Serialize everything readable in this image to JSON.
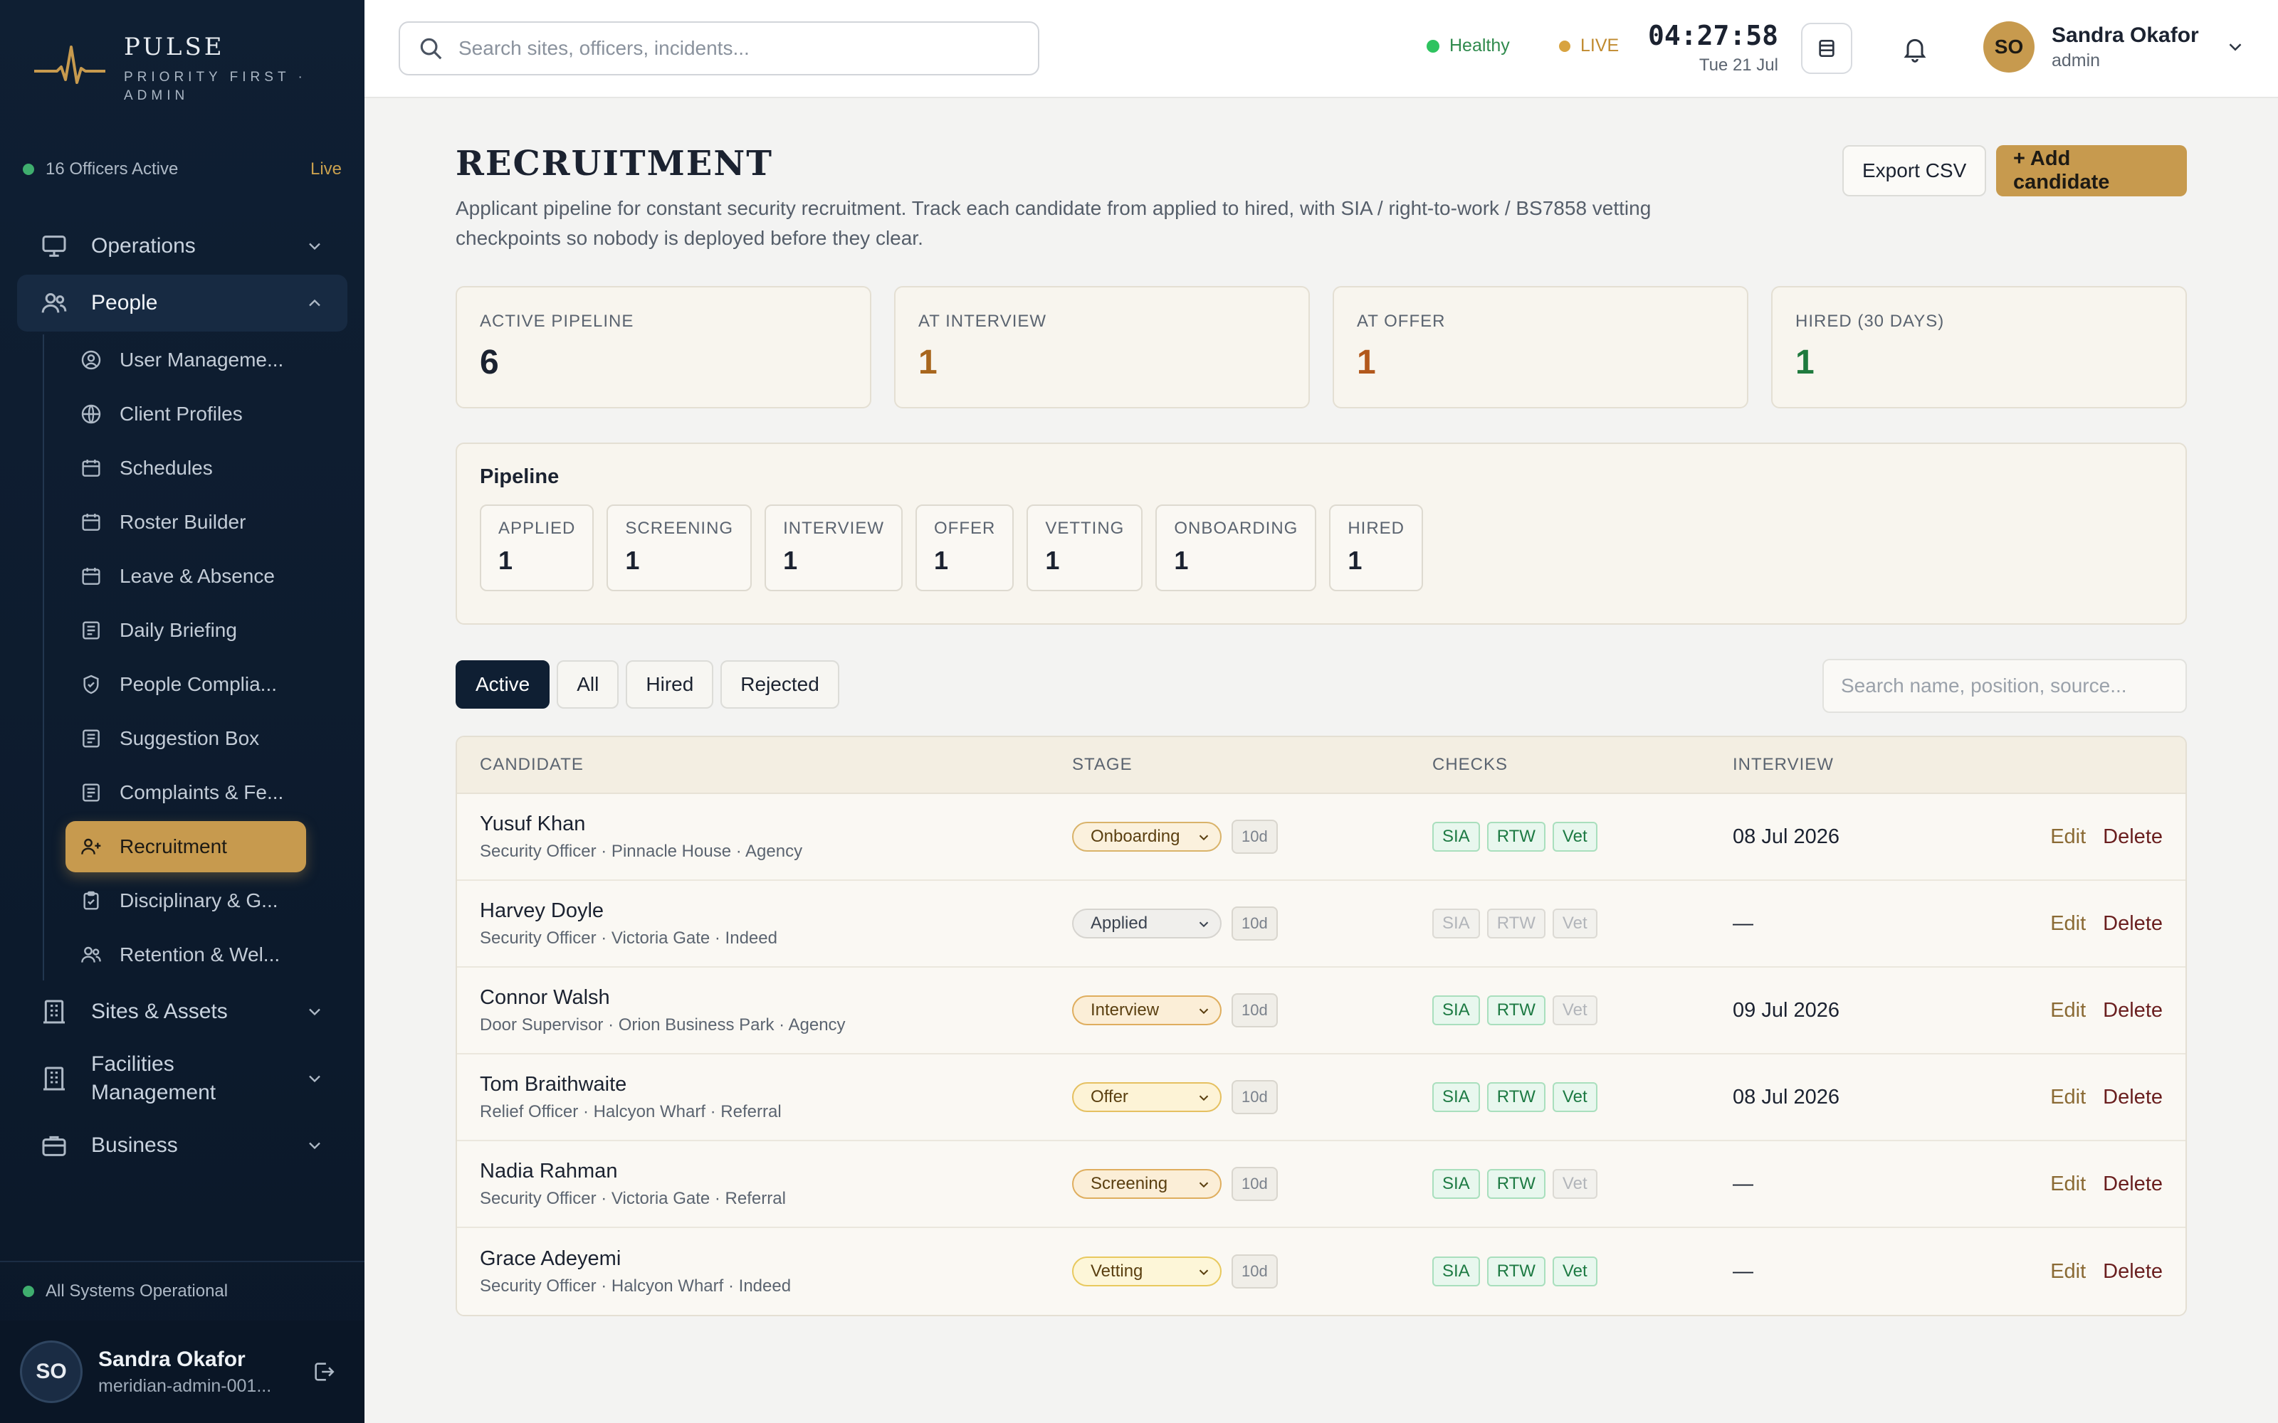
{
  "brand": {
    "name": "PULSE",
    "subtitle": "PRIORITY FIRST · ADMIN"
  },
  "sidebar": {
    "officers_active": "16 Officers Active",
    "live_label": "Live",
    "nav": {
      "operations": "Operations",
      "people": "People",
      "sites_assets": "Sites & Assets",
      "facilities": "Facilities Management",
      "business": "Business"
    },
    "people_items": [
      {
        "label": "User Manageme...",
        "icon": "user-circle-icon"
      },
      {
        "label": "Client Profiles",
        "icon": "globe-icon"
      },
      {
        "label": "Schedules",
        "icon": "calendar-icon"
      },
      {
        "label": "Roster Builder",
        "icon": "calendar-icon"
      },
      {
        "label": "Leave & Absence",
        "icon": "calendar-icon"
      },
      {
        "label": "Daily Briefing",
        "icon": "document-icon"
      },
      {
        "label": "People Complia...",
        "icon": "shield-check-icon"
      },
      {
        "label": "Suggestion Box",
        "icon": "document-icon"
      },
      {
        "label": "Complaints & Fe...",
        "icon": "document-icon"
      },
      {
        "label": "Recruitment",
        "icon": "user-plus-icon"
      },
      {
        "label": "Disciplinary & G...",
        "icon": "clipboard-icon"
      },
      {
        "label": "Retention & Wel...",
        "icon": "users-icon"
      }
    ],
    "system_status": "All Systems Operational",
    "user": {
      "initials": "SO",
      "name": "Sandra Okafor",
      "id": "meridian-admin-001..."
    }
  },
  "topbar": {
    "search_placeholder": "Search sites, officers, incidents...",
    "health": "Healthy",
    "live": "LIVE",
    "time": "04:27:58",
    "date": "Tue 21 Jul",
    "user": {
      "initials": "SO",
      "name": "Sandra Okafor",
      "role": "admin"
    }
  },
  "page": {
    "title": "RECRUITMENT",
    "description": "Applicant pipeline for constant security recruitment. Track each candidate from applied to hired, with SIA / right-to-work / BS7858 vetting checkpoints so nobody is deployed before they clear.",
    "export_label": "Export CSV",
    "add_label": "+ Add candidate"
  },
  "stats": [
    {
      "label": "ACTIVE PIPELINE",
      "value": "6",
      "color": "#1b2230"
    },
    {
      "label": "AT INTERVIEW",
      "value": "1",
      "color": "#a8661d"
    },
    {
      "label": "AT OFFER",
      "value": "1",
      "color": "#b2581c"
    },
    {
      "label": "HIRED (30 DAYS)",
      "value": "1",
      "color": "#1f7a3e"
    }
  ],
  "pipeline": {
    "title": "Pipeline",
    "stages": [
      {
        "label": "APPLIED",
        "count": "1"
      },
      {
        "label": "SCREENING",
        "count": "1"
      },
      {
        "label": "INTERVIEW",
        "count": "1"
      },
      {
        "label": "OFFER",
        "count": "1"
      },
      {
        "label": "VETTING",
        "count": "1"
      },
      {
        "label": "ONBOARDING",
        "count": "1"
      },
      {
        "label": "HIRED",
        "count": "1"
      }
    ]
  },
  "filters": {
    "tabs": [
      "Active",
      "All",
      "Hired",
      "Rejected"
    ],
    "search_placeholder": "Search name, position, source..."
  },
  "table": {
    "headers": {
      "candidate": "CANDIDATE",
      "stage": "STAGE",
      "checks": "CHECKS",
      "interview": "INTERVIEW"
    },
    "edit_label": "Edit",
    "delete_label": "Delete",
    "check_labels": [
      "SIA",
      "RTW",
      "Vet"
    ],
    "rows": [
      {
        "name": "Yusuf Khan",
        "meta": "Security Officer · Pinnacle House · Agency",
        "stage": "Onboarding",
        "stage_bg": "#fbf1dd",
        "stage_border": "#d9b36a",
        "stage_color": "#5a3f10",
        "days": "10d",
        "sia": true,
        "rtw": true,
        "vet": true,
        "interview": "08 Jul 2026"
      },
      {
        "name": "Harvey Doyle",
        "meta": "Security Officer · Victoria Gate · Indeed",
        "stage": "Applied",
        "stage_bg": "#f0efec",
        "stage_border": "#d6d4cf",
        "stage_color": "#3b4350",
        "days": "10d",
        "sia": false,
        "rtw": false,
        "vet": false,
        "interview": "—"
      },
      {
        "name": "Connor Walsh",
        "meta": "Door Supervisor · Orion Business Park · Agency",
        "stage": "Interview",
        "stage_bg": "#fbeed7",
        "stage_border": "#dfae5e",
        "stage_color": "#5a3f10",
        "days": "10d",
        "sia": true,
        "rtw": true,
        "vet": false,
        "interview": "09 Jul 2026"
      },
      {
        "name": "Tom Braithwaite",
        "meta": "Relief Officer · Halcyon Wharf · Referral",
        "stage": "Offer",
        "stage_bg": "#fdf3d6",
        "stage_border": "#e5c060",
        "stage_color": "#5a3f10",
        "days": "10d",
        "sia": true,
        "rtw": true,
        "vet": true,
        "interview": "08 Jul 2026"
      },
      {
        "name": "Nadia Rahman",
        "meta": "Security Officer · Victoria Gate · Referral",
        "stage": "Screening",
        "stage_bg": "#fbeed7",
        "stage_border": "#dfae5e",
        "stage_color": "#5a3f10",
        "days": "10d",
        "sia": true,
        "rtw": true,
        "vet": false,
        "interview": "—"
      },
      {
        "name": "Grace Adeyemi",
        "meta": "Security Officer · Halcyon Wharf · Indeed",
        "stage": "Vetting",
        "stage_bg": "#fdf6d8",
        "stage_border": "#e8c95e",
        "stage_color": "#5a3f10",
        "days": "10d",
        "sia": true,
        "rtw": true,
        "vet": true,
        "interview": "—"
      }
    ]
  }
}
